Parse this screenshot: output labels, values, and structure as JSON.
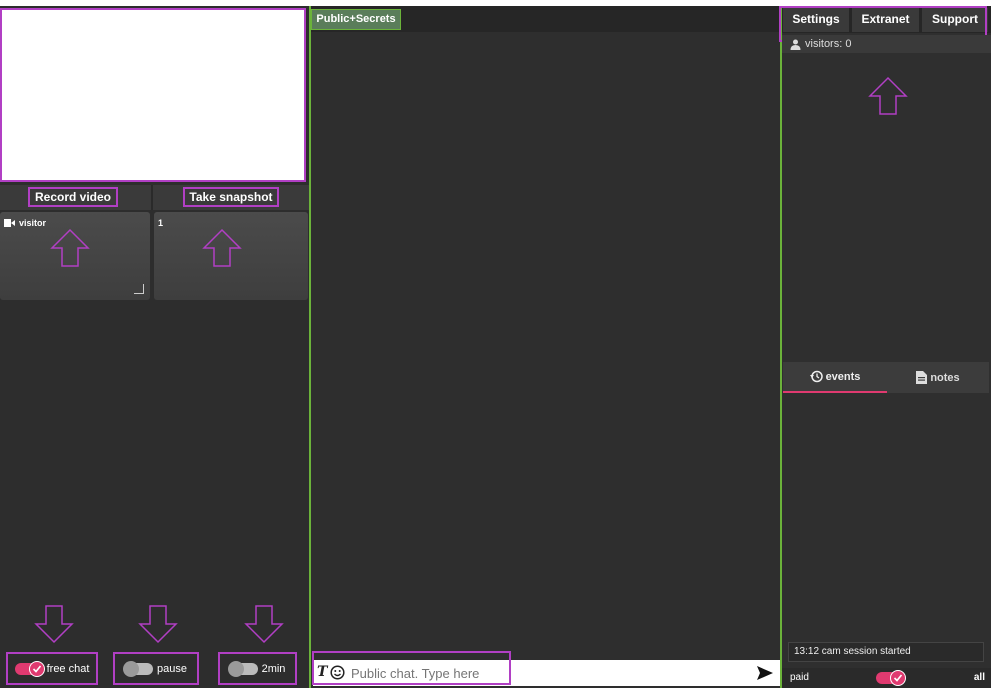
{
  "left": {
    "record_label": "Record video",
    "snapshot_label": "Take snapshot",
    "tiles": [
      {
        "label": "visitor"
      },
      {
        "label": "1"
      }
    ],
    "toggles": [
      {
        "label": "free chat",
        "state": "on"
      },
      {
        "label": "pause",
        "state": "off"
      },
      {
        "label": "2min",
        "state": "off"
      }
    ]
  },
  "middle": {
    "tab_label": "Public+Secrets",
    "chat_placeholder": "Public chat. Type here"
  },
  "right": {
    "buttons": [
      "Settings",
      "Extranet",
      "Support"
    ],
    "visitors_label": "visitors: 0",
    "tabs": {
      "events": "events",
      "notes": "notes"
    },
    "event_log": "13:12 cam session started",
    "footer": {
      "paid": "paid",
      "all": "all"
    }
  },
  "colors": {
    "accent_pink": "#e03a70",
    "accent_green": "#6bb33a",
    "highlight_purple": "#b13fc4"
  }
}
